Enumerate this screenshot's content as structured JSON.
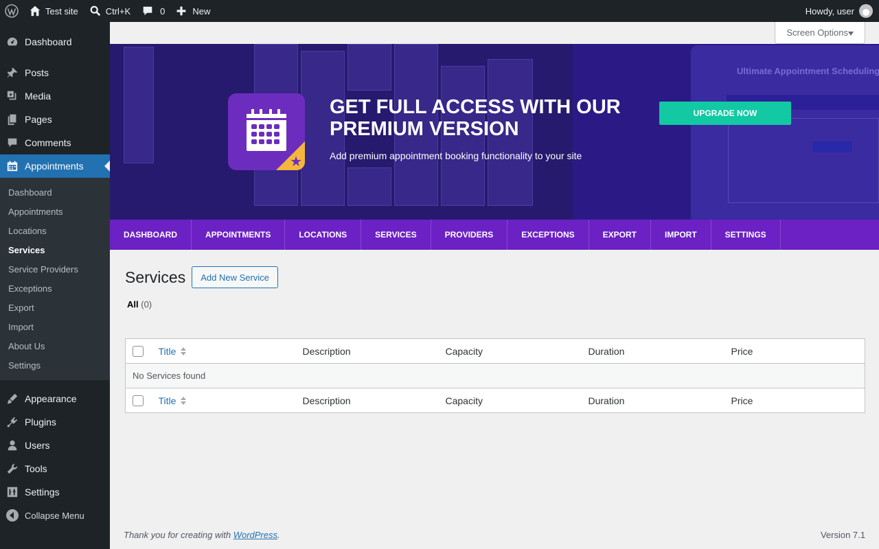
{
  "adminbar": {
    "site_name": "Test site",
    "search_shortcut": "Ctrl+K",
    "comments_count": "0",
    "new_label": "New",
    "howdy": "Howdy, user"
  },
  "sidebar": {
    "dashboard": "Dashboard",
    "posts": "Posts",
    "media": "Media",
    "pages": "Pages",
    "comments": "Comments",
    "appointments": "Appointments",
    "submenu": [
      "Dashboard",
      "Appointments",
      "Locations",
      "Services",
      "Service Providers",
      "Exceptions",
      "Export",
      "Import",
      "About Us",
      "Settings"
    ],
    "appearance": "Appearance",
    "plugins": "Plugins",
    "users": "Users",
    "tools": "Tools",
    "settings": "Settings",
    "collapse": "Collapse Menu"
  },
  "screen_options": "Screen Options",
  "banner": {
    "heading": "GET FULL ACCESS WITH OUR PREMIUM VERSION",
    "subtext": "Add premium appointment booking functionality to your site",
    "upgrade_label": "UPGRADE NOW",
    "bg_card_title": "Ultimate Appointment Scheduling",
    "accent_color": "#6b21c3",
    "button_color": "#12c9a4"
  },
  "plugin_nav": [
    "DASHBOARD",
    "APPOINTMENTS",
    "LOCATIONS",
    "SERVICES",
    "PROVIDERS",
    "EXCEPTIONS",
    "EXPORT",
    "IMPORT",
    "SETTINGS"
  ],
  "page": {
    "title": "Services",
    "add_new_label": "Add New Service",
    "filter_all": "All",
    "filter_count": "(0)"
  },
  "table": {
    "columns": [
      "Title",
      "Description",
      "Capacity",
      "Duration",
      "Price"
    ],
    "empty_message": "No Services found"
  },
  "footer": {
    "thanks_prefix": "Thank you for creating with ",
    "thanks_link": "WordPress",
    "thanks_suffix": ".",
    "version": "Version 7.1"
  }
}
